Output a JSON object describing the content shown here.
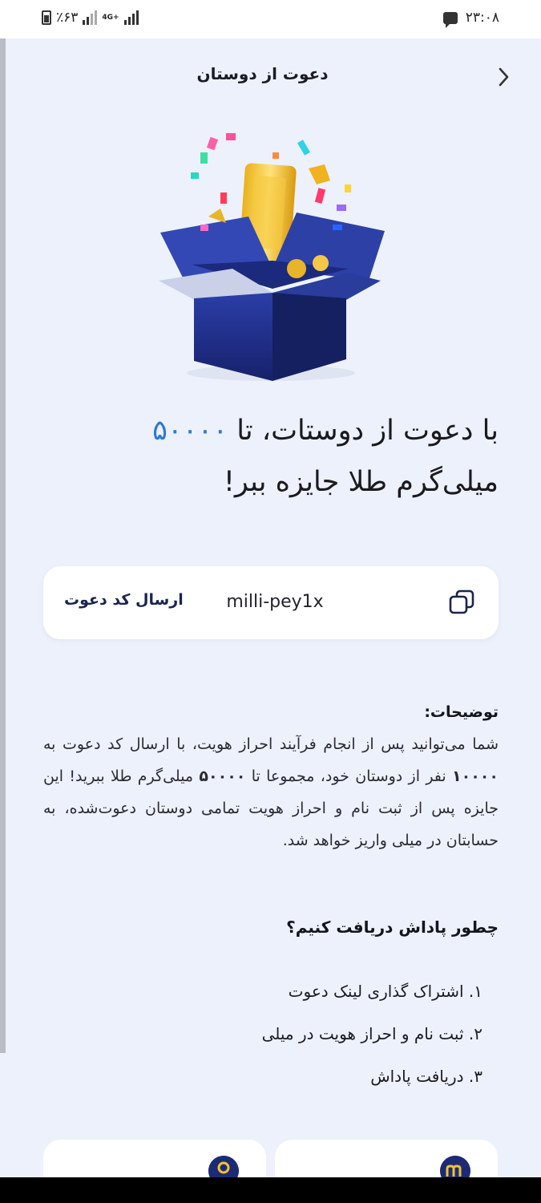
{
  "status_bar": {
    "time": "۲۳:۰۸",
    "battery": "٪۶۳",
    "network": "4G+"
  },
  "header": {
    "title": "دعوت از دوستان"
  },
  "hero": {
    "headline_part1": "با دعوت از دوستات، تا",
    "headline_amount": "۵۰۰۰۰",
    "headline_part2": "میلی‌گرم طلا جایزه ببر!"
  },
  "invite_card": {
    "code": "milli-pey1x",
    "send_label": "ارسال کد دعوت"
  },
  "description": {
    "title": "توضیحات:",
    "body_part1": "شما می‌توانید پس از انجام فرآیند احراز هویت، با ارسال کد دعوت به",
    "people_count": "۱۰۰۰۰",
    "body_part2": "نفر از دوستان خود، مجموعا تا",
    "amount": "۵۰۰۰۰",
    "body_part3": "میلی‌گرم طلا ببرید! این جایزه پس از ثبت نام و احراز هویت تمامی دوستان دعوت‌شده، به حسابتان در میلی واریز خواهد شد."
  },
  "how_to": {
    "title": "چطور پاداش دریافت کنیم؟",
    "steps": [
      "۱. اشتراک گذاری لینک دعوت",
      "۲. ثبت نام و احراز هویت در میلی",
      "۳. دریافت پاداش"
    ]
  },
  "colors": {
    "accent": "#2a7ad6",
    "navy": "#1c2b74",
    "background": "#edf1fb"
  }
}
